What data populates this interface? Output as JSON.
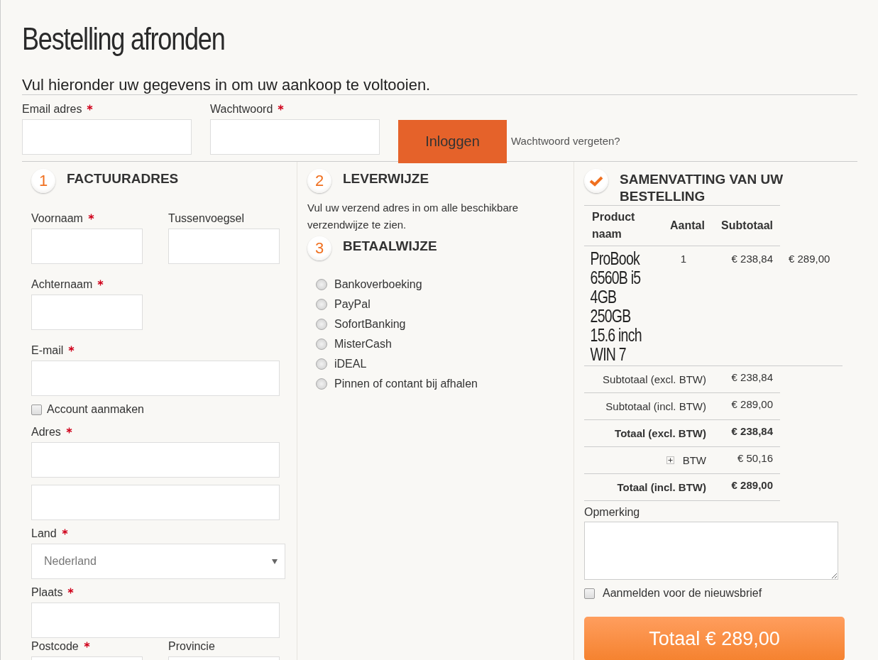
{
  "title": "Bestelling afronden",
  "subtitle": "Vul hieronder uw gegevens in om uw aankoop te voltooien.",
  "login": {
    "fields": [
      {
        "label": "Email adres",
        "required": true
      },
      {
        "label": "Wachtwoord",
        "required": true
      }
    ],
    "button": "Inloggen",
    "forgot_link": "Wachtwoord vergeten?"
  },
  "billing": {
    "step": "1",
    "heading": "FACTUURADRES",
    "rows": [
      [
        {
          "kind": "short",
          "label": "Voornaam",
          "required": true
        },
        {
          "kind": "short",
          "label": "Tussenvoegsel",
          "required": false
        }
      ],
      [
        {
          "kind": "short",
          "label": "Achternaam",
          "required": true
        }
      ],
      [
        {
          "kind": "text",
          "label": "E-mail",
          "required": true
        }
      ],
      [
        {
          "kind": "checkbox",
          "label": "Account aanmaken",
          "checked": false
        }
      ],
      [
        {
          "kind": "text",
          "label": "Adres",
          "required": true
        }
      ],
      [
        {
          "kind": "extra"
        }
      ],
      [
        {
          "kind": "select",
          "label": "Land",
          "required": true,
          "value": "Nederland"
        }
      ],
      [
        {
          "kind": "text",
          "label": "Plaats",
          "required": true
        }
      ],
      [
        {
          "kind": "short",
          "label": "Postcode",
          "required": true
        },
        {
          "kind": "short",
          "label": "Provincie",
          "required": false
        }
      ]
    ]
  },
  "delivery": {
    "step": "2",
    "heading": "LEVERWIJZE",
    "note": "Vul uw verzend adres in om alle beschikbare verzendwijze te zien."
  },
  "payment": {
    "step": "3",
    "heading": "BETAALWIJZE",
    "options": [
      {
        "label": "Bankoverboeking",
        "selected": false
      },
      {
        "label": "PayPal",
        "selected": false
      },
      {
        "label": "SofortBanking",
        "selected": false
      },
      {
        "label": "MisterCash",
        "selected": false
      },
      {
        "label": "iDEAL",
        "selected": false
      },
      {
        "label": "Pinnen of contant bij afhalen",
        "selected": false
      }
    ]
  },
  "summary": {
    "heading": "SAMENVATTING VAN UW BESTELLING",
    "columns": [
      "Product naam",
      "Aantal",
      "Subtotaal"
    ],
    "items": [
      {
        "name": "ProBook 6560B i5 4GB 250GB 15.6 inch WIN 7",
        "quantity": "1",
        "subtotal": "€ 238,84",
        "total": "€ 289,00"
      }
    ],
    "totals": [
      {
        "label": "Subtotaal (excl. BTW)",
        "value": "€ 238,84",
        "emphasized": false,
        "expandable": false
      },
      {
        "label": "Subtotaal (incl. BTW)",
        "value": "€ 289,00",
        "emphasized": false,
        "expandable": false
      },
      {
        "label": "Totaal (excl. BTW)",
        "value": "€ 238,84",
        "emphasized": true,
        "expandable": false
      },
      {
        "label": "BTW",
        "value": "€ 50,16",
        "emphasized": false,
        "expandable": true
      },
      {
        "label": "Totaal (incl. BTW)",
        "value": "€ 289,00",
        "emphasized": true,
        "expandable": false
      }
    ]
  },
  "remark": {
    "label": "Opmerking"
  },
  "newsletter": {
    "label": "Aanmelden voor de nieuwsbrief",
    "checked": false
  },
  "total_button": "Totaal € 289,00"
}
